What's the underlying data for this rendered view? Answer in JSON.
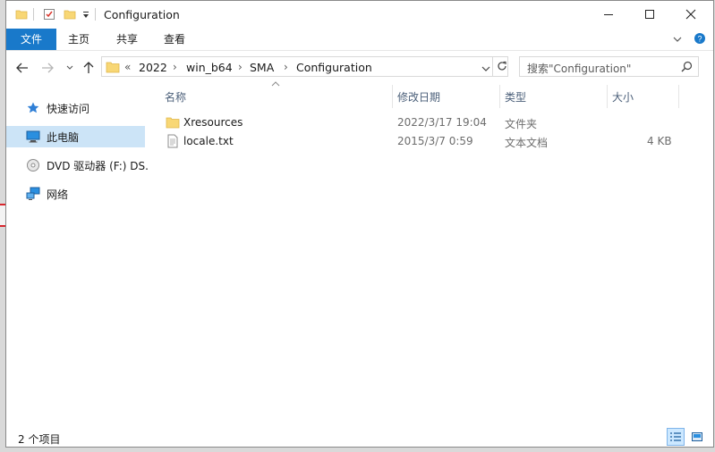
{
  "window": {
    "title": "Configuration",
    "quick_access_icons": [
      "folder-icon",
      "properties-checkmark-icon",
      "new-folder-icon",
      "customize-dropdown-icon"
    ],
    "controls": [
      "minimize-icon",
      "maximize-icon",
      "close-icon"
    ]
  },
  "ribbon": {
    "tabs": [
      {
        "label": "文件",
        "active": true
      },
      {
        "label": "主页"
      },
      {
        "label": "共享"
      },
      {
        "label": "查看"
      }
    ]
  },
  "address": {
    "overflow": "«",
    "crumbs": [
      "2022",
      "win_b64",
      "SMA",
      "Configuration"
    ],
    "separator": "›"
  },
  "search": {
    "placeholder": "搜索\"Configuration\""
  },
  "nav_pane": {
    "items": [
      {
        "label": "快速访问",
        "icon": "star-icon"
      },
      {
        "label": "此电脑",
        "icon": "pc-icon",
        "selected": true
      },
      {
        "label": "DVD 驱动器 (F:) DS.",
        "icon": "dvd-drive-icon"
      },
      {
        "label": "网络",
        "icon": "network-icon"
      }
    ]
  },
  "columns": {
    "name": "名称",
    "date": "修改日期",
    "type": "类型",
    "size": "大小"
  },
  "files": [
    {
      "name": "Xresources",
      "date": "2022/3/17 19:04",
      "type": "文件夹",
      "size": "",
      "icon": "folder-icon"
    },
    {
      "name": "locale.txt",
      "date": "2015/3/7 0:59",
      "type": "文本文档",
      "size": "4 KB",
      "icon": "text-file-icon"
    }
  ],
  "status": {
    "count": "2 个项目"
  },
  "colors": {
    "accent": "#1979ca",
    "selection": "#cce4f7",
    "folder": "#f8d775"
  }
}
